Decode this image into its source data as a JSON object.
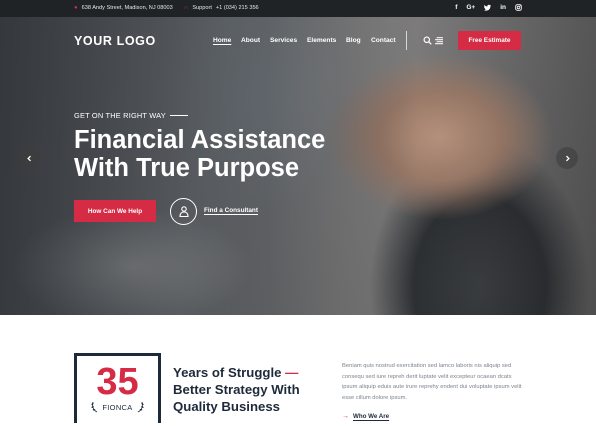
{
  "topbar": {
    "address": "638 Andy Street, Madison, NJ 08003",
    "support_label": "Support",
    "phone": "+1 (034) 215 356",
    "social": [
      "facebook-icon",
      "google-plus-icon",
      "twitter-icon",
      "linkedin-icon",
      "instagram-icon"
    ],
    "social_glyphs": {
      "facebook": "f",
      "google": "G+",
      "linkedin": "in"
    }
  },
  "header": {
    "logo": "YOUR LOGO",
    "nav": [
      "Home",
      "About",
      "Services",
      "Elements",
      "Blog",
      "Contact"
    ],
    "estimate_button": "Free Estimate"
  },
  "hero": {
    "kicker": "GET ON THE RIGHT WAY",
    "headline": "Financial Assistance With True Purpose",
    "cta_button": "How Can We Help",
    "consultant_link": "Find a Consultant"
  },
  "stats": {
    "number": "35",
    "brand": "FIONCA",
    "heading_lines": [
      "Years of Struggle",
      "Better Strategy With",
      "Quality Business"
    ],
    "dash": "—",
    "paragraph": "Beniam quis nostrud exercitation sed lamco laboris nis aliquip sed consequ sed iure repreh derit luptate velit excepteur ocaean dcats ipsum aliquip eduis aute irure reprehy endent dui voluptate ipsum velit esse cillum dolore ipsum.",
    "link": "Who We Are"
  },
  "colors": {
    "accent": "#d62b44",
    "navy": "#1e2a3a",
    "topbar_bg": "#1f2326"
  }
}
